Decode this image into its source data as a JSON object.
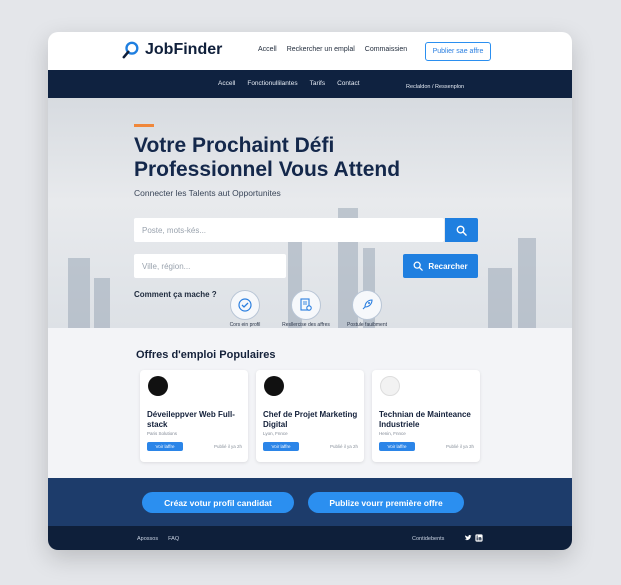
{
  "header": {
    "brand": "JobFinder",
    "nav": [
      "Accell",
      "Reckercher un emplal",
      "Commaissien"
    ],
    "publish_label": "Publier sae affre"
  },
  "navbar": {
    "links": [
      "Accell",
      "Fonctionullilantes",
      "Tarifs",
      "Contact"
    ],
    "right_text": "Reclaldon / Ressenplon"
  },
  "hero": {
    "title": "Votre Prochaint Défi Professionnel Vous Attend",
    "subtitle": "Connecter les Talents aut Opportunites",
    "search_placeholder": "Poste, mots-kés...",
    "city_placeholder": "Ville, région...",
    "find_label": "Recarcher",
    "how_title": "Comment ça mache ?",
    "steps": [
      {
        "label": "Cors ein profil",
        "icon": "check-icon"
      },
      {
        "label": "Resllercise des affres",
        "icon": "document-search-icon"
      },
      {
        "label": "Postule fauibment",
        "icon": "rocket-icon"
      }
    ]
  },
  "offers": {
    "title": "Offres d'emploi Populaires",
    "cards": [
      {
        "title": "Déveileppver Web Full-stack",
        "location": "Paris Solutions",
        "button": "Voir laffre",
        "date": "Publié il ya 2h"
      },
      {
        "title": "Chef de Projet Marketing Digital",
        "location": "Lyon, Fnnce",
        "button": "Voir laffre",
        "date": "Publié il ya 2h"
      },
      {
        "title": "Technian de Mainteance Industriele",
        "location": "Henin, Fnnce",
        "button": "Voir laffre",
        "date": "Publié il ya 3h"
      }
    ]
  },
  "cta": {
    "candidate_label": "Créaz votur profil candidat",
    "offer_label": "Publize vourr première offre"
  },
  "footer": {
    "left": [
      "Apossos",
      "FAQ"
    ],
    "right": "Contidebents"
  },
  "colors": {
    "primary": "#1f7fe0",
    "navy": "#0f2240",
    "accent": "#f0873a"
  }
}
